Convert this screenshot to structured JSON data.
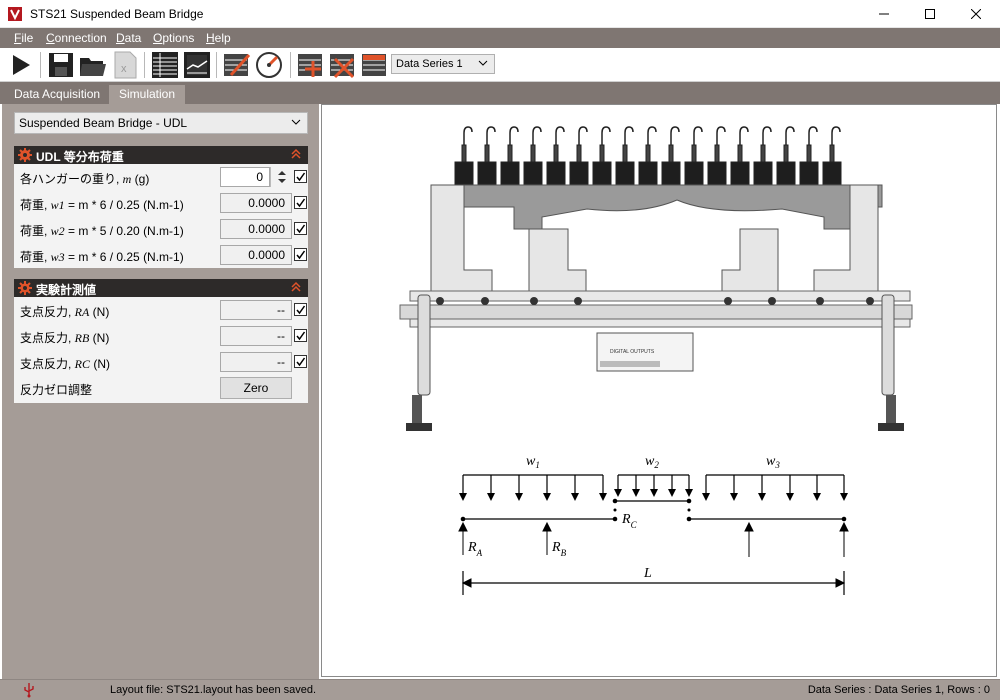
{
  "window": {
    "title": "STS21 Suspended Beam Bridge",
    "controls": [
      "minimize-icon",
      "maximize-icon",
      "close-icon"
    ]
  },
  "menu": {
    "items": [
      "File",
      "Connection",
      "Data",
      "Options",
      "Help"
    ]
  },
  "toolbar": {
    "icons": [
      "play-icon",
      "save-icon",
      "open-folder-icon",
      "export-excel-icon",
      "table-view-icon",
      "graph-view-icon",
      "edit-graph-icon",
      "meter-calibration-icon",
      "add-row-icon",
      "delete-row-icon",
      "clear-table-icon"
    ],
    "data_series_value": "Data Series 1"
  },
  "tabs": [
    {
      "label": "Data Acquisition",
      "active": false
    },
    {
      "label": "Simulation",
      "active": true
    }
  ],
  "simulation": {
    "selector_value": "Suspended Beam Bridge - UDL",
    "udl_group": {
      "title": "UDL  等分布荷重",
      "rows": [
        {
          "label_pre": "各ハンガーの重り, ",
          "label_var": "m",
          "label_post": "  (g)",
          "value": "0",
          "checked": true
        },
        {
          "label_pre": "荷重, ",
          "label_var": "w1",
          "label_post": " = m * 6 / 0.25 (N.m-1)",
          "value": "0.0000",
          "checked": true
        },
        {
          "label_pre": "荷重, ",
          "label_var": "w2",
          "label_post": " = m * 5 / 0.20 (N.m-1)",
          "value": "0.0000",
          "checked": true
        },
        {
          "label_pre": "荷重, ",
          "label_var": "w3",
          "label_post": " = m * 6 / 0.25 (N.m-1)",
          "value": "0.0000",
          "checked": true
        }
      ]
    },
    "measurement_group": {
      "title": "実験計測値",
      "rows": [
        {
          "label_pre": "支点反力, ",
          "label_var": "RA",
          "label_post": " (N)",
          "value": "--",
          "checked": true
        },
        {
          "label_pre": "支点反力, ",
          "label_var": "RB",
          "label_post": " (N)",
          "value": "--",
          "checked": true
        },
        {
          "label_pre": "支点反力, ",
          "label_var": "RC",
          "label_post": " (N)",
          "value": "--",
          "checked": true
        }
      ],
      "zero_label": "反力ゼロ調整",
      "zero_button": "Zero"
    }
  },
  "diagram": {
    "labels": {
      "w1": "w",
      "w1_sub": "1",
      "w2": "w",
      "w2_sub": "2",
      "w3": "w",
      "w3_sub": "3",
      "rc": "R",
      "rc_sub": "C",
      "ra": "R",
      "ra_sub": "A",
      "rb": "R",
      "rb_sub": "B",
      "span": "L"
    },
    "instrument_text": "DIGITAL OUTPUTS"
  },
  "status": {
    "left": "Layout file: STS21.layout has been saved.",
    "right": "Data Series : Data Series 1,   Rows : 0",
    "icon": "usb-icon"
  },
  "colors": {
    "chrome": "#7f7672",
    "pane": "#a59c97",
    "group_header": "#2d2a29",
    "logo": "#b4181f",
    "accent_orange": "#e0532a"
  }
}
